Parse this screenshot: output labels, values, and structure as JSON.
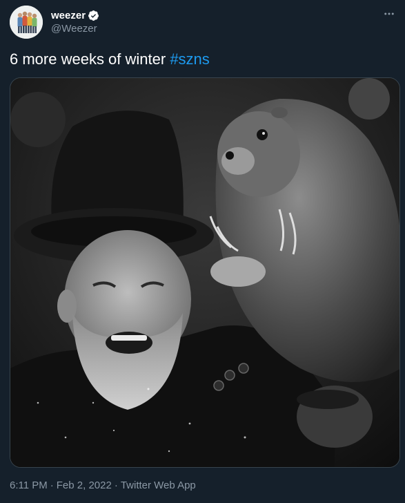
{
  "author": {
    "display_name": "weezer",
    "handle": "@Weezer",
    "verified": true,
    "avatar_icon": "band-photo-avatar",
    "verified_icon": "verified-badge-icon"
  },
  "tweet": {
    "text_plain": "6 more weeks of winter ",
    "hashtag": "#szns",
    "media_description_icon": "groundhog-photo"
  },
  "meta": {
    "time": "6:11 PM",
    "separator": "·",
    "date": "Feb 2, 2022",
    "source": "Twitter Web App"
  },
  "colors": {
    "background": "#15202b",
    "text": "#ffffff",
    "secondary_text": "#8b98a5",
    "accent": "#1d9bf0"
  }
}
